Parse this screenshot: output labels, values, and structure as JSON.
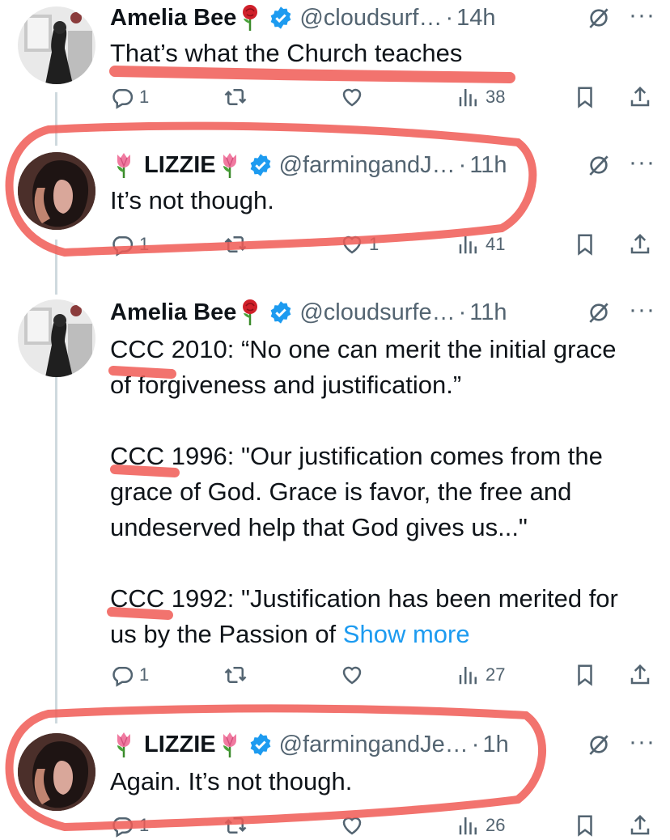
{
  "colors": {
    "accent": "#1d9bf0",
    "muted": "#536471",
    "annotation": "#f05a55"
  },
  "tweets": [
    {
      "name": "Amelia Bee",
      "name_emoji": "rose-emoji",
      "handle": "@cloudsurf…",
      "dot": "·",
      "time": "14h",
      "text": "That’s what the Church teaches",
      "replies": "1",
      "retweets": "",
      "likes": "",
      "views": "38"
    },
    {
      "name": "LIZZIE",
      "name_emoji": "tulip-emoji",
      "handle": "@farmingandJ…",
      "dot": "·",
      "time": "11h",
      "text": "It’s not though.",
      "replies": "1",
      "retweets": "",
      "likes": "1",
      "views": "41"
    },
    {
      "name": "Amelia Bee",
      "name_emoji": "rose-emoji",
      "handle": "@cloudsurfe…",
      "dot": "·",
      "time": "11h",
      "text": "CCC 2010: “No one can merit the initial grace of forgiveness and justification.”\n\nCCC 1996: \"Our justification comes from the grace of God. Grace is favor, the free and undeserved help that God gives us...\"\n\nCCC 1992: \"Justification has been merited for us by the Passion of ",
      "show_more": "Show more",
      "replies": "1",
      "retweets": "",
      "likes": "",
      "views": "27"
    },
    {
      "name": "LIZZIE",
      "name_emoji": "tulip-emoji",
      "handle": "@farmingandJe…",
      "dot": "·",
      "time": "1h",
      "text": "Again. It’s not though.",
      "replies": "1",
      "retweets": "",
      "likes": "",
      "views": "26"
    }
  ]
}
